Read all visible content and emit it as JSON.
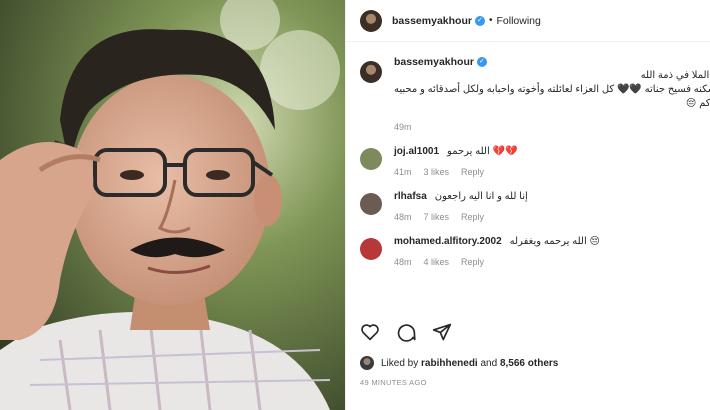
{
  "post": {
    "author": "bassemyakhour",
    "follow_state": "Following",
    "separator": "•",
    "caption_lines": [
      "المخرج بسام الملا في ذمة الله",
      "رحمه الله واسكنه فسيح جناته 🖤🖤 كل العزاء لعائلته وأخوته واحبابه ولكل أصدقائه و محبيه",
      "عظم الله أجركم 😔"
    ],
    "caption_time": "49m",
    "liked_by_prefix": "Liked by",
    "liked_by_user": "rabihhenedi",
    "liked_by_and": "and",
    "likes_count": "8,566 others",
    "posted_ago": "49 MINUTES AGO"
  },
  "comments": [
    {
      "user": "joj.al1001",
      "text": "الله يرحمو 💔💔",
      "time": "41m",
      "likes": "3 likes",
      "reply": "Reply",
      "avatar_color": "#7d8a5e"
    },
    {
      "user": "rlhafsa",
      "text": "إنا لله و انا اليه راجعون",
      "time": "48m",
      "likes": "7 likes",
      "reply": "Reply",
      "avatar_color": "#6b5c53"
    },
    {
      "user": "mohamed.alfitory.2002",
      "text": "الله يرحمه ويغفرله 😔",
      "time": "48m",
      "likes": "4 likes",
      "reply": "Reply",
      "avatar_color": "#b73838"
    }
  ],
  "icons": {
    "like": "heart-icon",
    "comment": "comment-icon",
    "share": "share-icon",
    "verified": "verified-badge-icon"
  },
  "colors": {
    "verified": "#3897f0",
    "muted": "#8e8e8e",
    "text": "#262626"
  }
}
